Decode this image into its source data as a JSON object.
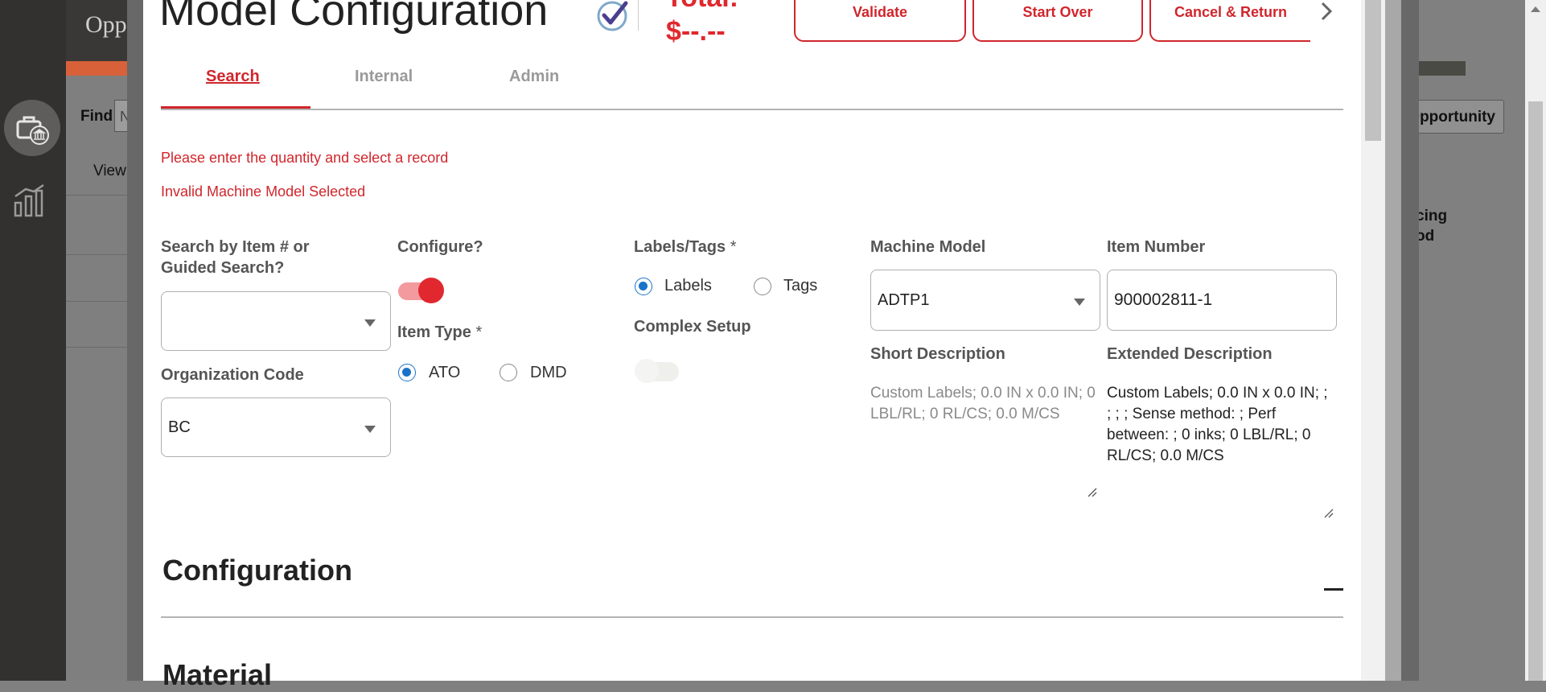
{
  "background": {
    "app_title": "Opp",
    "find_label": "Find",
    "find_input_value": "N",
    "view_label": "View",
    "opportunity_button": "Opportunity",
    "pricing_header_line1": "cing",
    "pricing_header_line2": "od"
  },
  "modal": {
    "title": "Model Configuration",
    "total_label": "Total:",
    "total_value": "$--.--",
    "buttons": {
      "validate": "Validate",
      "start_over": "Start Over",
      "cancel_return": "Cancel & Return"
    },
    "tabs": [
      {
        "label": "Search",
        "active": true
      },
      {
        "label": "Internal",
        "active": false
      },
      {
        "label": "Admin",
        "active": false
      }
    ],
    "errors": [
      "Please enter the quantity and select a record",
      "Invalid Machine Model Selected"
    ],
    "form": {
      "search_by_label": "Search by Item # or Guided Search?",
      "search_by_value": "",
      "organization_code_label": "Organization Code",
      "organization_code_value": "BC",
      "configure_label": "Configure?",
      "configure_on": true,
      "item_type_label": "Item Type",
      "required_mark": "*",
      "item_type_options": [
        "ATO",
        "DMD"
      ],
      "item_type_selected": "ATO",
      "labels_tags_label": "Labels/Tags",
      "labels_tags_options": [
        "Labels",
        "Tags"
      ],
      "labels_tags_selected": "Labels",
      "complex_setup_label": "Complex Setup",
      "complex_setup_on": false,
      "machine_model_label": "Machine Model",
      "machine_model_value": "ADTP1",
      "item_number_label": "Item Number",
      "item_number_value": "900002811-1",
      "short_description_label": "Short Description",
      "short_description_value": "Custom Labels; 0.0 IN x 0.0 IN; 0 LBL/RL; 0 RL/CS; 0.0 M/CS",
      "extended_description_label": "Extended Description",
      "extended_description_value": "Custom  Labels; 0.0 IN x 0.0 IN; ; ; ; ; Sense method: ; Perf between: ; 0 inks; 0 LBL/RL; 0 RL/CS; 0.0 M/CS"
    },
    "sections": {
      "configuration": "Configuration",
      "material": "Material"
    }
  },
  "colors": {
    "accent_red": "#d0262c",
    "radio_blue": "#1a73c8"
  }
}
